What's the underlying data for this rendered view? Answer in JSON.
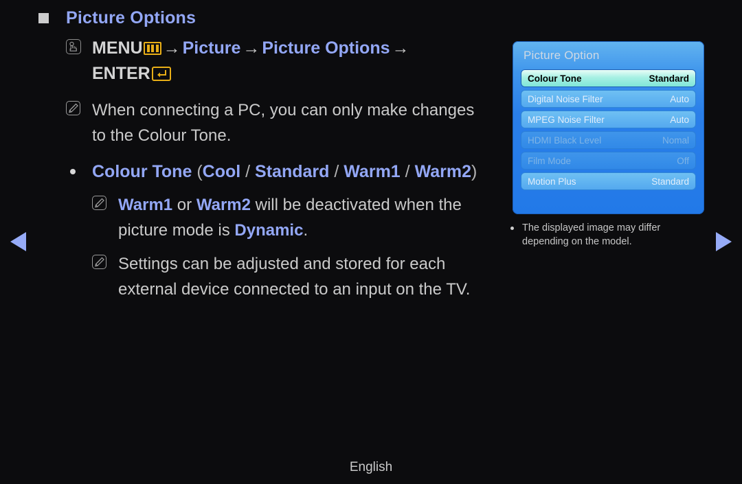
{
  "page": {
    "background_color": "#0c0c0e",
    "accent_blue": "#93a7f5",
    "accent_gold": "#e8ae17",
    "heading": "Picture Options",
    "footer_language": "English"
  },
  "menu_path": {
    "press_icon": "hand-press-icon",
    "menu_label": "MENU",
    "menu_icon": "menu-bars-icon",
    "arrow": "→",
    "step_picture": "Picture",
    "step_picture_options": "Picture Options",
    "enter_label": "ENTER",
    "enter_icon": "enter-return-icon"
  },
  "notes": [
    {
      "icon": "note-pencil-icon",
      "segments": [
        {
          "text": "When connecting a ",
          "style": "plain"
        },
        {
          "text": "PC",
          "style": "bold-blue"
        },
        {
          "text": ", you can only make changes to the ",
          "style": "plain"
        },
        {
          "text": "Colour Tone",
          "style": "bold-blue"
        },
        {
          "text": ".",
          "style": "plain"
        }
      ],
      "line1": "When connecting a PC, you can only make changes",
      "line2": "to the Colour Tone."
    }
  ],
  "option_bullet": {
    "bullet_icon": "bullet-dot-icon",
    "label": "Colour Tone",
    "open_paren": "(",
    "close_paren": ")",
    "separator": "/",
    "options": [
      "Cool",
      "Standard",
      "Warm1",
      "Warm2"
    ]
  },
  "subnotes": [
    {
      "icon": "note-pencil-icon",
      "line1_pre": "",
      "bold1": "Warm1",
      "mid": " or ",
      "bold2": "Warm2",
      "tail": " will be deactivated when the",
      "line2_pre": "picture mode is ",
      "bold3": "Dynamic",
      "line2_post": "."
    },
    {
      "icon": "note-pencil-icon",
      "line1": "Settings can be adjusted and stored for each",
      "line2": "external device connected to an input on the TV."
    }
  ],
  "osd": {
    "title": "Picture Option",
    "panel_color_top": "#63b4ef",
    "panel_color_bottom": "#2279e8",
    "selected_row_color": "#a7f0e3",
    "rows": [
      {
        "label": "Colour Tone",
        "value": "Standard",
        "state": "selected"
      },
      {
        "label": "Digital Noise Filter",
        "value": "Auto",
        "state": "normal"
      },
      {
        "label": "MPEG Noise Filter",
        "value": "Auto",
        "state": "normal"
      },
      {
        "label": "HDMI Black Level",
        "value": "Nomal",
        "state": "disabled"
      },
      {
        "label": "Film Mode",
        "value": "Off",
        "state": "disabled"
      },
      {
        "label": "Motion Plus",
        "value": "Standard",
        "state": "normal"
      }
    ],
    "caption_line1": "The displayed image may differ",
    "caption_line2": "depending on the model."
  },
  "navigation": {
    "prev_icon": "triangle-left-icon",
    "next_icon": "triangle-right-icon"
  }
}
